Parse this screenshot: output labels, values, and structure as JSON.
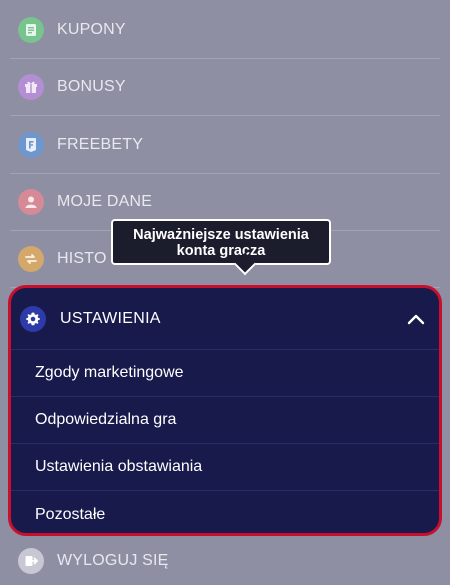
{
  "menu": {
    "items": [
      {
        "label": "KUPONY",
        "icon": "coupon-icon",
        "color": "#78c48e"
      },
      {
        "label": "BONUSY",
        "icon": "gift-icon",
        "color": "#b48ed4"
      },
      {
        "label": "FREEBETY",
        "icon": "freebet-icon",
        "color": "#6f97cf"
      },
      {
        "label": "MOJE DANE",
        "icon": "user-icon",
        "color": "#d68a96"
      },
      {
        "label": "HISTO",
        "icon": "history-icon",
        "color": "#d3a86a"
      }
    ],
    "settings": {
      "label": "USTAWIENIA",
      "icon": "gear-icon",
      "expanded": true,
      "sub_items": [
        "Zgody marketingowe",
        "Odpowiedzialna gra",
        "Ustawienia obstawiania",
        "Pozostałe"
      ]
    },
    "logout": {
      "label": "WYLOGUJ SIĘ",
      "icon": "logout-icon",
      "color": "#c8c8d4"
    }
  },
  "tooltip": {
    "line1": "Najważniejsze ustawienia",
    "line2": "konta gracza"
  },
  "colors": {
    "accent_border": "#c8102e",
    "panel_bg": "#171a4b",
    "backdrop": "#8e8fa2"
  }
}
